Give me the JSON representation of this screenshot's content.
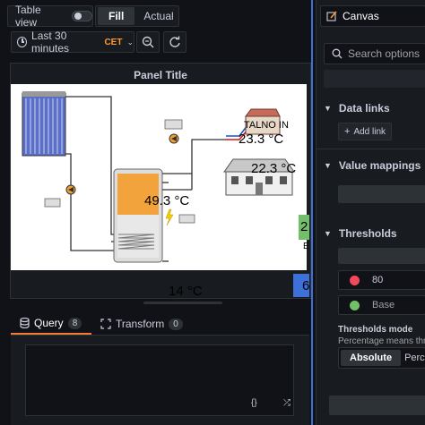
{
  "toolbar": {
    "table_view_label": "Table view",
    "fill_label": "Fill",
    "actual_label": "Actual",
    "time_range_label": "Last 30 minutes",
    "timezone_label": "CET"
  },
  "panel": {
    "title": "Panel Title",
    "canvas": {
      "talno_label": "TALNO IN",
      "talno_temp": "23.3 °C",
      "house_temp": "22.3 °C",
      "tank_temp": "49.3 °C",
      "outside_temp": "14 °C",
      "green_badge_text": "2",
      "small_e_text": "E",
      "blue_badge_text": "6"
    }
  },
  "tabs": {
    "query_label": "Query",
    "query_count": "8",
    "transform_label": "Transform",
    "transform_count": "0"
  },
  "editor": {
    "braces_label": "{}"
  },
  "right_pane": {
    "viz_name": "Canvas",
    "search_placeholder": "Search options",
    "data_links_title": "Data links",
    "add_link_label": "Add link",
    "value_mappings_title": "Value mappings",
    "thresholds_title": "Thresholds",
    "threshold_value": "80",
    "base_label": "Base",
    "thresholds_mode_title": "Thresholds mode",
    "thresholds_mode_desc": "Percentage means thresholds relative to min & max",
    "absolute_label": "Absolute",
    "percentage_label": "Percentage"
  },
  "colors": {
    "accent_blue": "#3d71d9",
    "threshold_red": "#f2495c",
    "threshold_green": "#73bf69",
    "tab_underline": "#f57a3a"
  }
}
